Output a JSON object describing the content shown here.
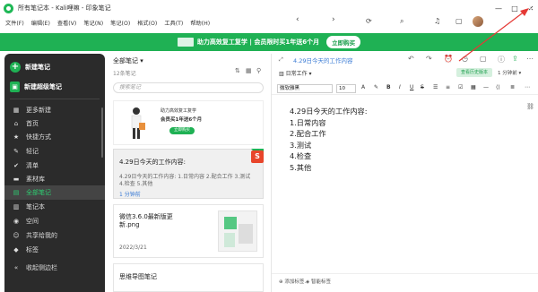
{
  "window": {
    "title": "所有笔记本 - Kali哩嘛 - 印象笔记",
    "controls": [
      "—",
      "□",
      "✕"
    ]
  },
  "menu": [
    "文件(F)",
    "编辑(E)",
    "查看(V)",
    "笔记(N)",
    "笔记(O)",
    "格式(O)",
    "工具(T)",
    "帮助(H)"
  ],
  "banner": {
    "text": "助力高效复工复学 | 会员限时买1年送6个月",
    "cta": "立即购买",
    "color": "#1fb154"
  },
  "sidebar": {
    "new_note": "新建笔记",
    "new_super_note": "新建超级笔记",
    "items": [
      {
        "label": "更多新建",
        "icon": "grid-icon"
      },
      {
        "label": "首页",
        "icon": "home-icon"
      },
      {
        "label": "快捷方式",
        "icon": "star-icon"
      },
      {
        "label": "轻记",
        "icon": "pen-icon"
      },
      {
        "label": "清单",
        "icon": "check-icon"
      },
      {
        "label": "素材库",
        "icon": "folder-icon"
      },
      {
        "label": "全部笔记",
        "icon": "notes-icon",
        "active": true
      },
      {
        "label": "笔记本",
        "icon": "notebook-icon"
      },
      {
        "label": "空间",
        "icon": "space-icon"
      },
      {
        "label": "共享给我的",
        "icon": "share-icon"
      },
      {
        "label": "标签",
        "icon": "tag-icon"
      }
    ],
    "collapse": "收起侧边栏"
  },
  "list": {
    "title": "全部笔记",
    "count": "12条笔记",
    "search_placeholder": "搜索笔记",
    "promo": {
      "line1": "助力高效复工复学",
      "line2": "会员买1年送6个月",
      "button": "立即购买"
    },
    "notes": [
      {
        "title": "4.29日今天的工作内容:",
        "preview": "4.29日今天的工作内容: 1.日常内容 2.配合工作 3.测试 4.检查 5.其他",
        "meta": "1 分钟前"
      },
      {
        "title": "微信3.6.0最新版更新.png",
        "meta": "2022/3/21"
      },
      {
        "title": "思维导图笔记"
      }
    ]
  },
  "editor": {
    "note_link": "4.29日今天的工作内容",
    "notebook": "日常工作",
    "history_button": "查看历史版本",
    "save_status": "1 分钟前",
    "font": "微软雅黑",
    "font_size": "10",
    "content": [
      "4.29日今天的工作内容:",
      "1.日常内容",
      "2.配合工作",
      "3.测试",
      "4.检查",
      "5.其他"
    ],
    "add_tag": "添加标签...",
    "smart_tag": "智能标签"
  },
  "colors": {
    "brand": "#1fb154",
    "sidebar_bg": "#2b2b2b",
    "link": "#3a7bd5",
    "annotation": "#e53935"
  }
}
